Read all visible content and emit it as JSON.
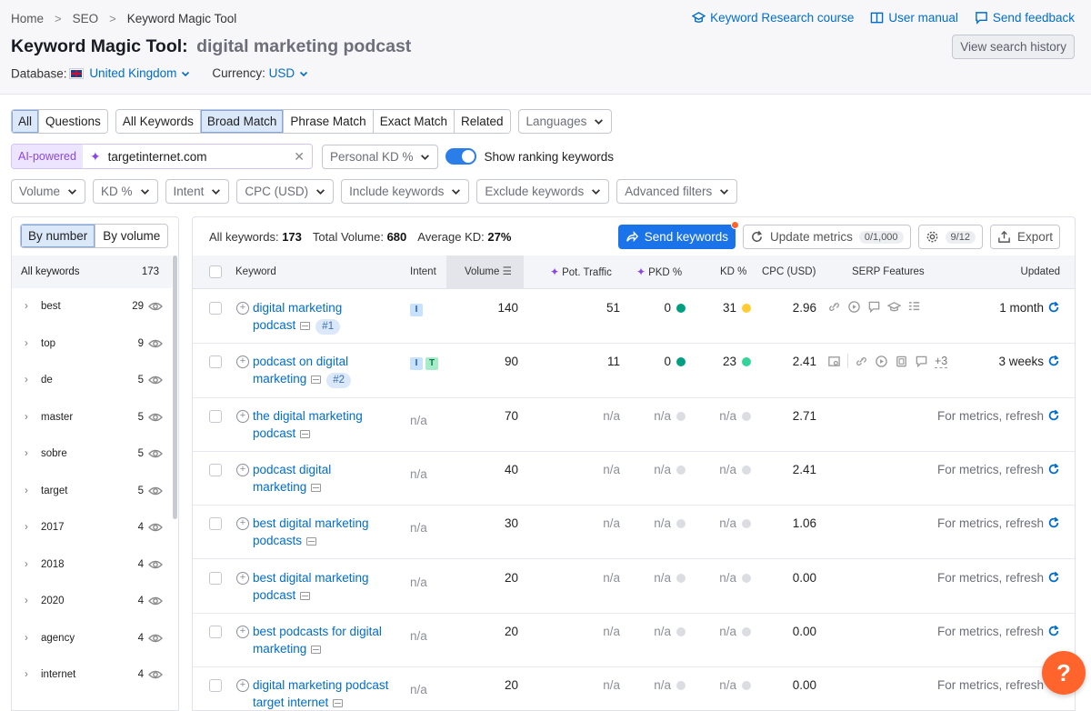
{
  "breadcrumb": [
    "Home",
    "SEO",
    "Keyword Magic Tool"
  ],
  "top_links": {
    "course": "Keyword Research course",
    "manual": "User manual",
    "feedback": "Send feedback"
  },
  "title": {
    "tool": "Keyword Magic Tool:",
    "query": "digital marketing podcast"
  },
  "history_button": "View search history",
  "database": {
    "label": "Database:",
    "value": "United Kingdom"
  },
  "currency": {
    "label": "Currency:",
    "value": "USD"
  },
  "filters": {
    "scope_tabs": [
      "All",
      "Questions"
    ],
    "match_tabs": [
      "All Keywords",
      "Broad Match",
      "Phrase Match",
      "Exact Match",
      "Related"
    ],
    "languages": "Languages",
    "ai_label": "AI-powered",
    "ai_domain": "targetinternet.com",
    "personal_kd": "Personal KD %",
    "show_ranking": "Show ranking keywords",
    "row3": [
      "Volume",
      "KD %",
      "Intent",
      "CPC (USD)",
      "Include keywords",
      "Exclude keywords",
      "Advanced filters"
    ]
  },
  "sidebar": {
    "toggle": [
      "By number",
      "By volume"
    ],
    "head": {
      "label": "All keywords",
      "count": "173"
    },
    "items": [
      {
        "name": "best",
        "count": "29"
      },
      {
        "name": "top",
        "count": "9"
      },
      {
        "name": "de",
        "count": "5"
      },
      {
        "name": "master",
        "count": "5"
      },
      {
        "name": "sobre",
        "count": "5"
      },
      {
        "name": "target",
        "count": "5"
      },
      {
        "name": "2017",
        "count": "4"
      },
      {
        "name": "2018",
        "count": "4"
      },
      {
        "name": "2020",
        "count": "4"
      },
      {
        "name": "agency",
        "count": "4"
      },
      {
        "name": "internet",
        "count": "4"
      }
    ]
  },
  "summary": {
    "all_label": "All keywords:",
    "all_value": "173",
    "vol_label": "Total Volume:",
    "vol_value": "680",
    "kd_label": "Average KD:",
    "kd_value": "27%"
  },
  "actions": {
    "send": "Send keywords",
    "update": "Update metrics",
    "update_count": "0/1,000",
    "settings_count": "9/12",
    "export": "Export"
  },
  "columns": [
    "Keyword",
    "Intent",
    "Volume",
    "Pot. Traffic",
    "PKD %",
    "KD %",
    "CPC (USD)",
    "SERP Features",
    "Updated"
  ],
  "rows": [
    {
      "kw1": "digital marketing",
      "kw2": "podcast",
      "rank": "#1",
      "intent": [
        "I"
      ],
      "volume": "140",
      "pot": "51",
      "pkd": "0",
      "pkd_color": "#009f81",
      "kd": "31",
      "kd_color": "#ffcc33",
      "cpc": "2.96",
      "updated": "1 month",
      "serp": [
        "link-icon",
        "play-icon",
        "comment-icon",
        "education-icon",
        "list-icon"
      ],
      "serp_more": ""
    },
    {
      "kw1": "podcast on digital",
      "kw2": "marketing",
      "rank": "#2",
      "intent": [
        "I",
        "T"
      ],
      "volume": "90",
      "pot": "11",
      "pkd": "0",
      "pkd_color": "#009f81",
      "kd": "23",
      "kd_color": "#34d399",
      "cpc": "2.41",
      "updated": "3 weeks",
      "serp": [
        "image-search-icon",
        "link-icon",
        "play-icon",
        "video-icon",
        "comment-icon"
      ],
      "serp_more": "+3"
    },
    {
      "kw1": "the digital marketing",
      "kw2": "podcast",
      "rank": "",
      "intent": [],
      "volume": "70",
      "pot": "n/a",
      "pkd": "n/a",
      "kd": "n/a",
      "cpc": "2.71",
      "updated": "For metrics, refresh"
    },
    {
      "kw1": "podcast digital",
      "kw2": "marketing",
      "rank": "",
      "intent": [],
      "volume": "40",
      "pot": "n/a",
      "pkd": "n/a",
      "kd": "n/a",
      "cpc": "2.41",
      "updated": "For metrics, refresh"
    },
    {
      "kw1": "best digital marketing",
      "kw2": "podcasts",
      "rank": "",
      "intent": [],
      "volume": "30",
      "pot": "n/a",
      "pkd": "n/a",
      "kd": "n/a",
      "cpc": "1.06",
      "updated": "For metrics, refresh"
    },
    {
      "kw1": "best digital marketing",
      "kw2": "podcast",
      "rank": "",
      "intent": [],
      "volume": "20",
      "pot": "n/a",
      "pkd": "n/a",
      "kd": "n/a",
      "cpc": "0.00",
      "updated": "For metrics, refresh"
    },
    {
      "kw1": "best podcasts for digital",
      "kw2": "marketing",
      "rank": "",
      "intent": [],
      "volume": "20",
      "pot": "n/a",
      "pkd": "n/a",
      "kd": "n/a",
      "cpc": "0.00",
      "updated": "For metrics, refresh"
    },
    {
      "kw1": "digital marketing podcast",
      "kw2": "target internet",
      "rank": "",
      "intent": [],
      "volume": "20",
      "pot": "n/a",
      "pkd": "n/a",
      "kd": "n/a",
      "cpc": "0.00",
      "updated": "For metrics, refresh"
    }
  ],
  "na_text": "n/a",
  "help": "?"
}
